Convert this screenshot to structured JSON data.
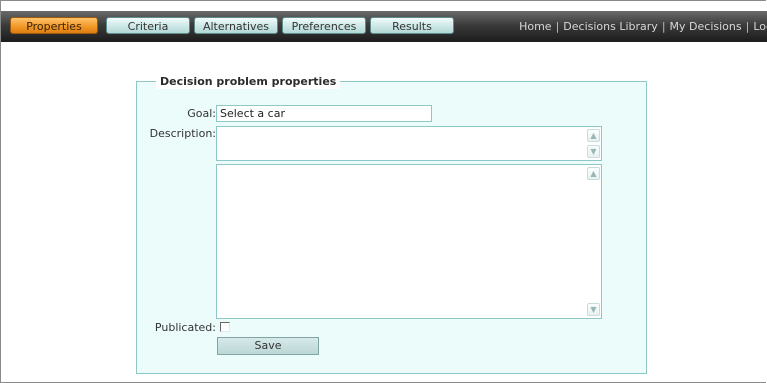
{
  "nav": {
    "tabs": [
      {
        "label": "Properties",
        "active": true
      },
      {
        "label": "Criteria",
        "active": false
      },
      {
        "label": "Alternatives",
        "active": false
      },
      {
        "label": "Preferences",
        "active": false
      },
      {
        "label": "Results",
        "active": false
      }
    ],
    "links": [
      "Home",
      "Decisions Library",
      "My Decisions",
      "Logout"
    ]
  },
  "form": {
    "legend": "Decision problem properties",
    "goal_label": "Goal:",
    "goal_value": "Select a car",
    "description_label": "Description:",
    "publicated_label": "Publicated:",
    "publicated_checked": false,
    "save_label": "Save"
  },
  "colors": {
    "active_tab": "#f29a2a",
    "tab": "#cfe9e8",
    "panel_bg": "#ebfcfb",
    "panel_border": "#8ec8c6"
  }
}
